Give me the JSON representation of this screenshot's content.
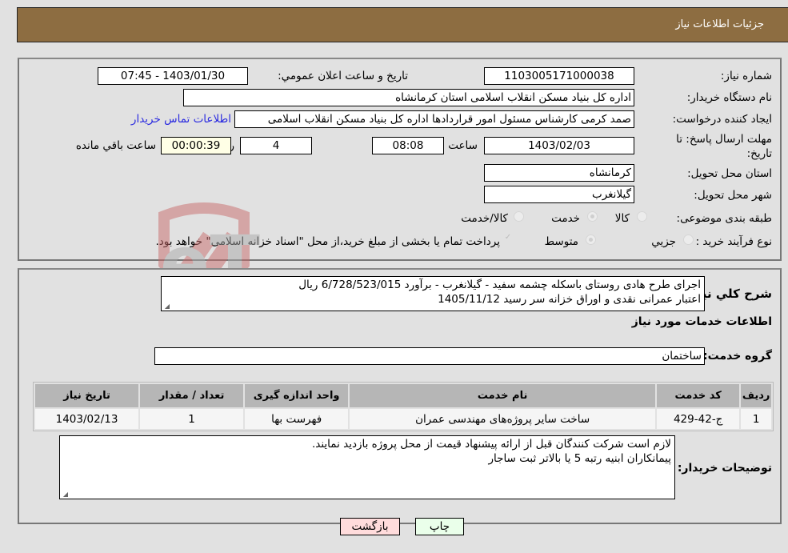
{
  "header": {
    "title": "جزئیات اطلاعات نیاز"
  },
  "form": {
    "need_number": {
      "label": "شماره نیاز:",
      "value": "1103005171000038"
    },
    "announce_datetime": {
      "label": "تاریخ و ساعت اعلان عمومي:",
      "value": "1403/01/30 - 07:45"
    },
    "buyer_org": {
      "label": "نام دستگاه خریدار:",
      "value": "اداره کل بنیاد مسکن انقلاب اسلامی استان کرمانشاه"
    },
    "requester": {
      "label": "ایجاد کننده درخواست:",
      "value": "صمد کرمی کارشناس مسئول امور قراردادها اداره کل بنیاد مسکن انقلاب اسلامی",
      "contact_link": "اطلاعات تماس خریدار"
    },
    "deadline": {
      "label": "مهلت ارسال پاسخ: تا تاریخ:",
      "date": "1403/02/03",
      "time_label": "ساعت",
      "time": "08:08",
      "days": "4",
      "days_label": "روز و",
      "remaining": "00:00:39",
      "remaining_label": "ساعت باقي مانده"
    },
    "province": {
      "label": "استان محل تحویل:",
      "value": "کرمانشاه"
    },
    "city": {
      "label": "شهر محل تحویل:",
      "value": "گیلانغرب"
    },
    "category": {
      "label": "طبقه بندی موضوعی:",
      "options": [
        "کالا",
        "خدمت",
        "کالا/خدمت"
      ],
      "selected": "خدمت"
    },
    "purchase_type": {
      "label": "نوع فرآیند خرید :",
      "options": [
        "جزيي",
        "متوسط"
      ],
      "selected": "متوسط",
      "treasury_note": "پرداخت تمام یا بخشی از مبلغ خرید،از محل \"اسناد خزانه اسلامی\" خواهد بود.",
      "treasury_checked": true
    }
  },
  "description": {
    "label": "شرح كلي نياز:",
    "line1": "اجرای طرح هادی روستای باسکله چشمه سفید - گیلانغرب - برآورد 6/728/523/015 ریال",
    "line2": "اعتبار عمرانی نقدی و اوراق خزانه سر رسید 1405/11/12"
  },
  "services": {
    "section_title": "اطلاعات خدمات مورد نیاز",
    "group_label": "گروه خدمت:",
    "group_value": "ساختمان",
    "columns": [
      "ردیف",
      "کد خدمت",
      "نام خدمت",
      "واحد اندازه گیری",
      "تعداد / مقدار",
      "تاریخ نیاز"
    ],
    "rows": [
      [
        "1",
        "ج-42-429",
        "ساخت سایر پروژه‌های مهندسی عمران",
        "فهرست بها",
        "1",
        "1403/02/13"
      ]
    ]
  },
  "buyer_notes": {
    "label": "توضیحات خریدار:",
    "line1": "لازم است شرکت کنندگان قبل از ارائه پیشنهاد قیمت از محل پروژه بازدید نمایند.",
    "line2": "پیمانکاران ابنیه رتبه 5 یا بالاتر ثبت ساجار"
  },
  "buttons": {
    "print": "چاپ",
    "back": "بازگشت"
  },
  "colors": {
    "header_bg": "#8d6d41",
    "link": "#2a2ae0",
    "print_bg": "#eaffea",
    "back_bg": "#ffdcdc"
  }
}
